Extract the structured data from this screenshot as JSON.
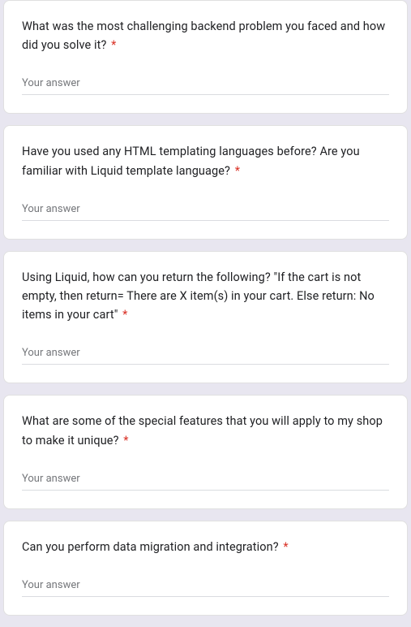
{
  "placeholder": "Your answer",
  "required_marker": "*",
  "questions": [
    {
      "text": "What was the most challenging backend problem you faced and how did you solve it?",
      "required": true
    },
    {
      "text": "Have you used any HTML templating languages before? Are you familiar with Liquid template language?",
      "required": true
    },
    {
      "text": "Using Liquid, how can you return the following? \"If the cart is not empty, then return= There are X item(s) in your cart. Else return: No items in your cart\"",
      "required": true
    },
    {
      "text": "What are some of the special features that you will apply to my shop to make it unique?",
      "required": true
    },
    {
      "text": "Can you perform data migration and integration?",
      "required": true
    }
  ]
}
